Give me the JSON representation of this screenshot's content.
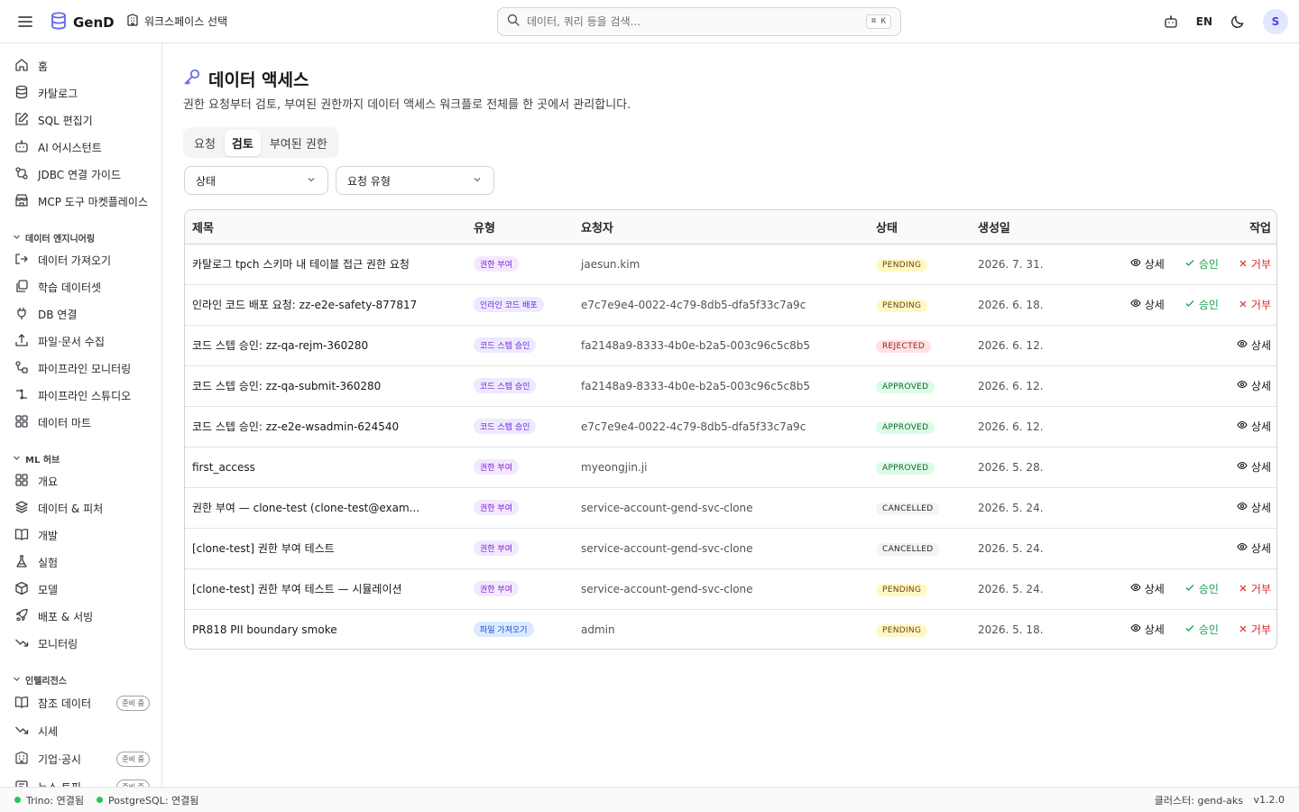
{
  "topbar": {
    "app_name": "GenD",
    "workspace_label": "워크스페이스 선택",
    "search_placeholder": "데이터, 쿼리 등을 검색...",
    "search_shortcut": "⌘ K",
    "lang": "EN",
    "avatar_initial": "S"
  },
  "sidebar": {
    "main_items": [
      {
        "label": "홈",
        "icon": "home-icon"
      },
      {
        "label": "카탈로그",
        "icon": "database-icon"
      },
      {
        "label": "SQL 편집기",
        "icon": "edit-icon"
      },
      {
        "label": "AI 어시스턴트",
        "icon": "bot-icon"
      },
      {
        "label": "JDBC 연결 가이드",
        "icon": "connection-icon"
      },
      {
        "label": "MCP 도구 마켓플레이스",
        "icon": "store-icon"
      }
    ],
    "sections": [
      {
        "title": "데이터 엔지니어링",
        "items": [
          {
            "label": "데이터 가져오기",
            "icon": "import-icon"
          },
          {
            "label": "학습 데이터셋",
            "icon": "dataset-icon"
          },
          {
            "label": "DB 연결",
            "icon": "plug-icon"
          },
          {
            "label": "파일·문서 수집",
            "icon": "upload-icon"
          },
          {
            "label": "파이프라인 모니터링",
            "icon": "pipeline-icon"
          },
          {
            "label": "파이프라인 스튜디오",
            "icon": "workflow-icon"
          },
          {
            "label": "데이터 마트",
            "icon": "grid-icon"
          }
        ]
      },
      {
        "title": "ML 허브",
        "items": [
          {
            "label": "개요",
            "icon": "grid-icon"
          },
          {
            "label": "데이터 & 피처",
            "icon": "layers-icon"
          },
          {
            "label": "개발",
            "icon": "book-icon"
          },
          {
            "label": "실험",
            "icon": "flask-icon"
          },
          {
            "label": "모델",
            "icon": "cube-icon"
          },
          {
            "label": "배포 & 서빙",
            "icon": "rocket-icon"
          },
          {
            "label": "모니터링",
            "icon": "trend-icon"
          }
        ]
      },
      {
        "title": "인텔리전스",
        "items": [
          {
            "label": "참조 데이터",
            "icon": "book-icon",
            "badge": "준비 중"
          },
          {
            "label": "시세",
            "icon": "trend-icon"
          },
          {
            "label": "기업·공시",
            "icon": "building-icon",
            "badge": "준비 중"
          },
          {
            "label": "뉴스·토픽",
            "icon": "news-icon",
            "badge": "준비 중"
          }
        ]
      }
    ]
  },
  "main": {
    "title": "데이터 액세스",
    "description": "권한 요청부터 검토, 부여된 권한까지 데이터 액세스 워크플로 전체를 한 곳에서 관리합니다.",
    "tabs": [
      {
        "label": "요청",
        "active": false
      },
      {
        "label": "검토",
        "active": true
      },
      {
        "label": "부여된 권한",
        "active": false
      }
    ],
    "filters": {
      "status": "상태",
      "request_type": "요청 유형"
    },
    "columns": {
      "title": "제목",
      "type": "유형",
      "requester": "요청자",
      "status": "상태",
      "created": "생성일",
      "actions": "작업"
    },
    "action_labels": {
      "detail": "상세",
      "approve": "승인",
      "reject": "거부"
    },
    "rows": [
      {
        "title": "카탈로그 tpch 스키마 내 테이블 접근 권한 요청",
        "type": "권한 부여",
        "type_kind": "grant",
        "requester": "jaesun.kim",
        "status": "PENDING",
        "created": "2026. 7. 31."
      },
      {
        "title": "인라인 코드 배포 요청: zz-e2e-safety-877817",
        "type": "인라인 코드 배포",
        "type_kind": "code",
        "requester": "e7c7e9e4-0022-4c79-8db5-dfa5f33c7a9c",
        "status": "PENDING",
        "created": "2026. 6. 18."
      },
      {
        "title": "코드 스텝 승인: zz-qa-rejm-360280",
        "type": "코드 스텝 승인",
        "type_kind": "step",
        "requester": "fa2148a9-8333-4b0e-b2a5-003c96c5c8b5",
        "status": "REJECTED",
        "created": "2026. 6. 12."
      },
      {
        "title": "코드 스텝 승인: zz-qa-submit-360280",
        "type": "코드 스텝 승인",
        "type_kind": "step",
        "requester": "fa2148a9-8333-4b0e-b2a5-003c96c5c8b5",
        "status": "APPROVED",
        "created": "2026. 6. 12."
      },
      {
        "title": "코드 스텝 승인: zz-e2e-wsadmin-624540",
        "type": "코드 스텝 승인",
        "type_kind": "step",
        "requester": "e7c7e9e4-0022-4c79-8db5-dfa5f33c7a9c",
        "status": "APPROVED",
        "created": "2026. 6. 12."
      },
      {
        "title": "first_access",
        "type": "권한 부여",
        "type_kind": "grant",
        "requester": "myeongjin.ji",
        "status": "APPROVED",
        "created": "2026. 5. 28."
      },
      {
        "title": "권한 부여 — clone-test (clone-test@exam...",
        "type": "권한 부여",
        "type_kind": "grant",
        "requester": "service-account-gend-svc-clone",
        "status": "CANCELLED",
        "created": "2026. 5. 24."
      },
      {
        "title": "[clone-test] 권한 부여 테스트",
        "type": "권한 부여",
        "type_kind": "grant",
        "requester": "service-account-gend-svc-clone",
        "status": "CANCELLED",
        "created": "2026. 5. 24."
      },
      {
        "title": "[clone-test] 권한 부여 테스트 — 시뮬레이션",
        "type": "권한 부여",
        "type_kind": "grant",
        "requester": "service-account-gend-svc-clone",
        "status": "PENDING",
        "created": "2026. 5. 24."
      },
      {
        "title": "PR818 PII boundary smoke",
        "type": "파일 가져오기",
        "type_kind": "file",
        "requester": "admin",
        "status": "PENDING",
        "created": "2026. 5. 18."
      }
    ]
  },
  "footer": {
    "trino": "Trino: 연결됨",
    "postgres": "PostgreSQL: 연결됨",
    "cluster": "클러스터: gend-aks",
    "version": "v1.2.0"
  },
  "colors": {
    "accent": "#4f46e5",
    "border": "#e4e4e7",
    "status_ok": "#22c55e"
  }
}
